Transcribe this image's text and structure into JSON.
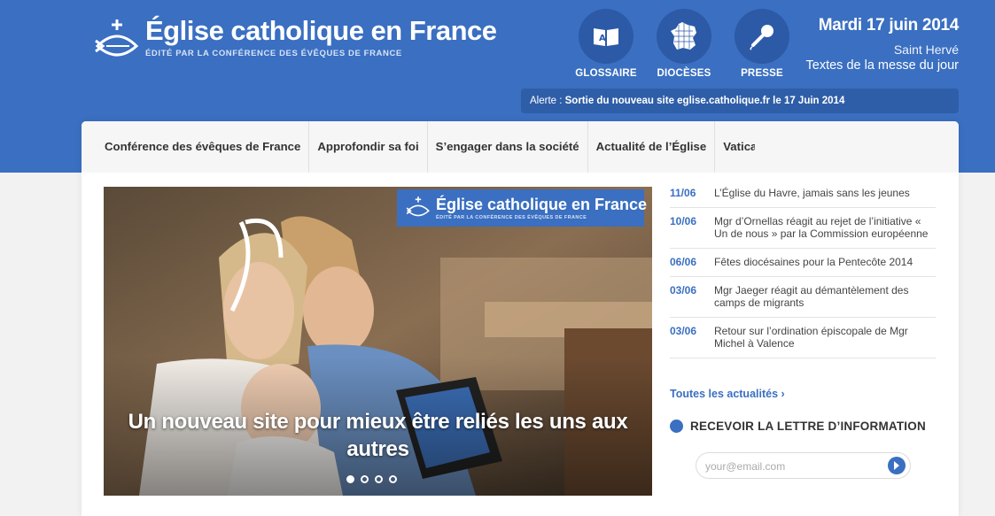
{
  "header": {
    "logo_title": "Église catholique en France",
    "logo_subtitle": "ÉDITÉ PAR LA CONFÉRENCE DES ÉVÊQUES DE FRANCE",
    "quick_links": [
      {
        "label": "GLOSSAIRE",
        "icon": "book-icon"
      },
      {
        "label": "DIOCÈSES",
        "icon": "france-map-icon"
      },
      {
        "label": "PRESSE",
        "icon": "microphone-icon"
      }
    ],
    "date": "Mardi 17 juin 2014",
    "saint": "Saint Hervé",
    "messe_link": "Textes de la messe du jour"
  },
  "alert": {
    "prefix": "Alerte :",
    "text": "Sortie du nouveau site eglise.catholique.fr le 17 Juin 2014"
  },
  "nav": {
    "items": [
      "Conférence des évêques de France",
      "Approfondir sa foi",
      "S’engager dans la société",
      "Actualité de l’Église",
      "Vatican"
    ]
  },
  "hero": {
    "logo_title": "Église catholique en France",
    "logo_subtitle": "ÉDITÉ PAR LA CONFÉRENCE DES ÉVÊQUES DE FRANCE",
    "caption": "Un nouveau site pour mieux être reliés les uns aux autres",
    "slides": 4,
    "active_slide": 1
  },
  "news": {
    "items": [
      {
        "date": "11/06",
        "title": "L’Église du Havre, jamais sans les jeunes"
      },
      {
        "date": "10/06",
        "title": "Mgr d’Ornellas réagit au rejet de l’initiative « Un de nous » par la Commission européenne"
      },
      {
        "date": "06/06",
        "title": "Fêtes diocésaines pour la Pentecôte 2014"
      },
      {
        "date": "03/06",
        "title": "Mgr Jaeger réagit au démantèlement des camps de migrants"
      },
      {
        "date": "03/06",
        "title": "Retour sur l’ordination épiscopale de Mgr Michel à Valence"
      }
    ],
    "all_link": "Toutes les actualités ›"
  },
  "newsletter": {
    "title": "RECEVOIR LA LETTRE D’INFORMATION",
    "placeholder": "your@email.com"
  },
  "colors": {
    "brand_blue": "#3a6fc1",
    "dark_blue": "#2c5aa6"
  }
}
